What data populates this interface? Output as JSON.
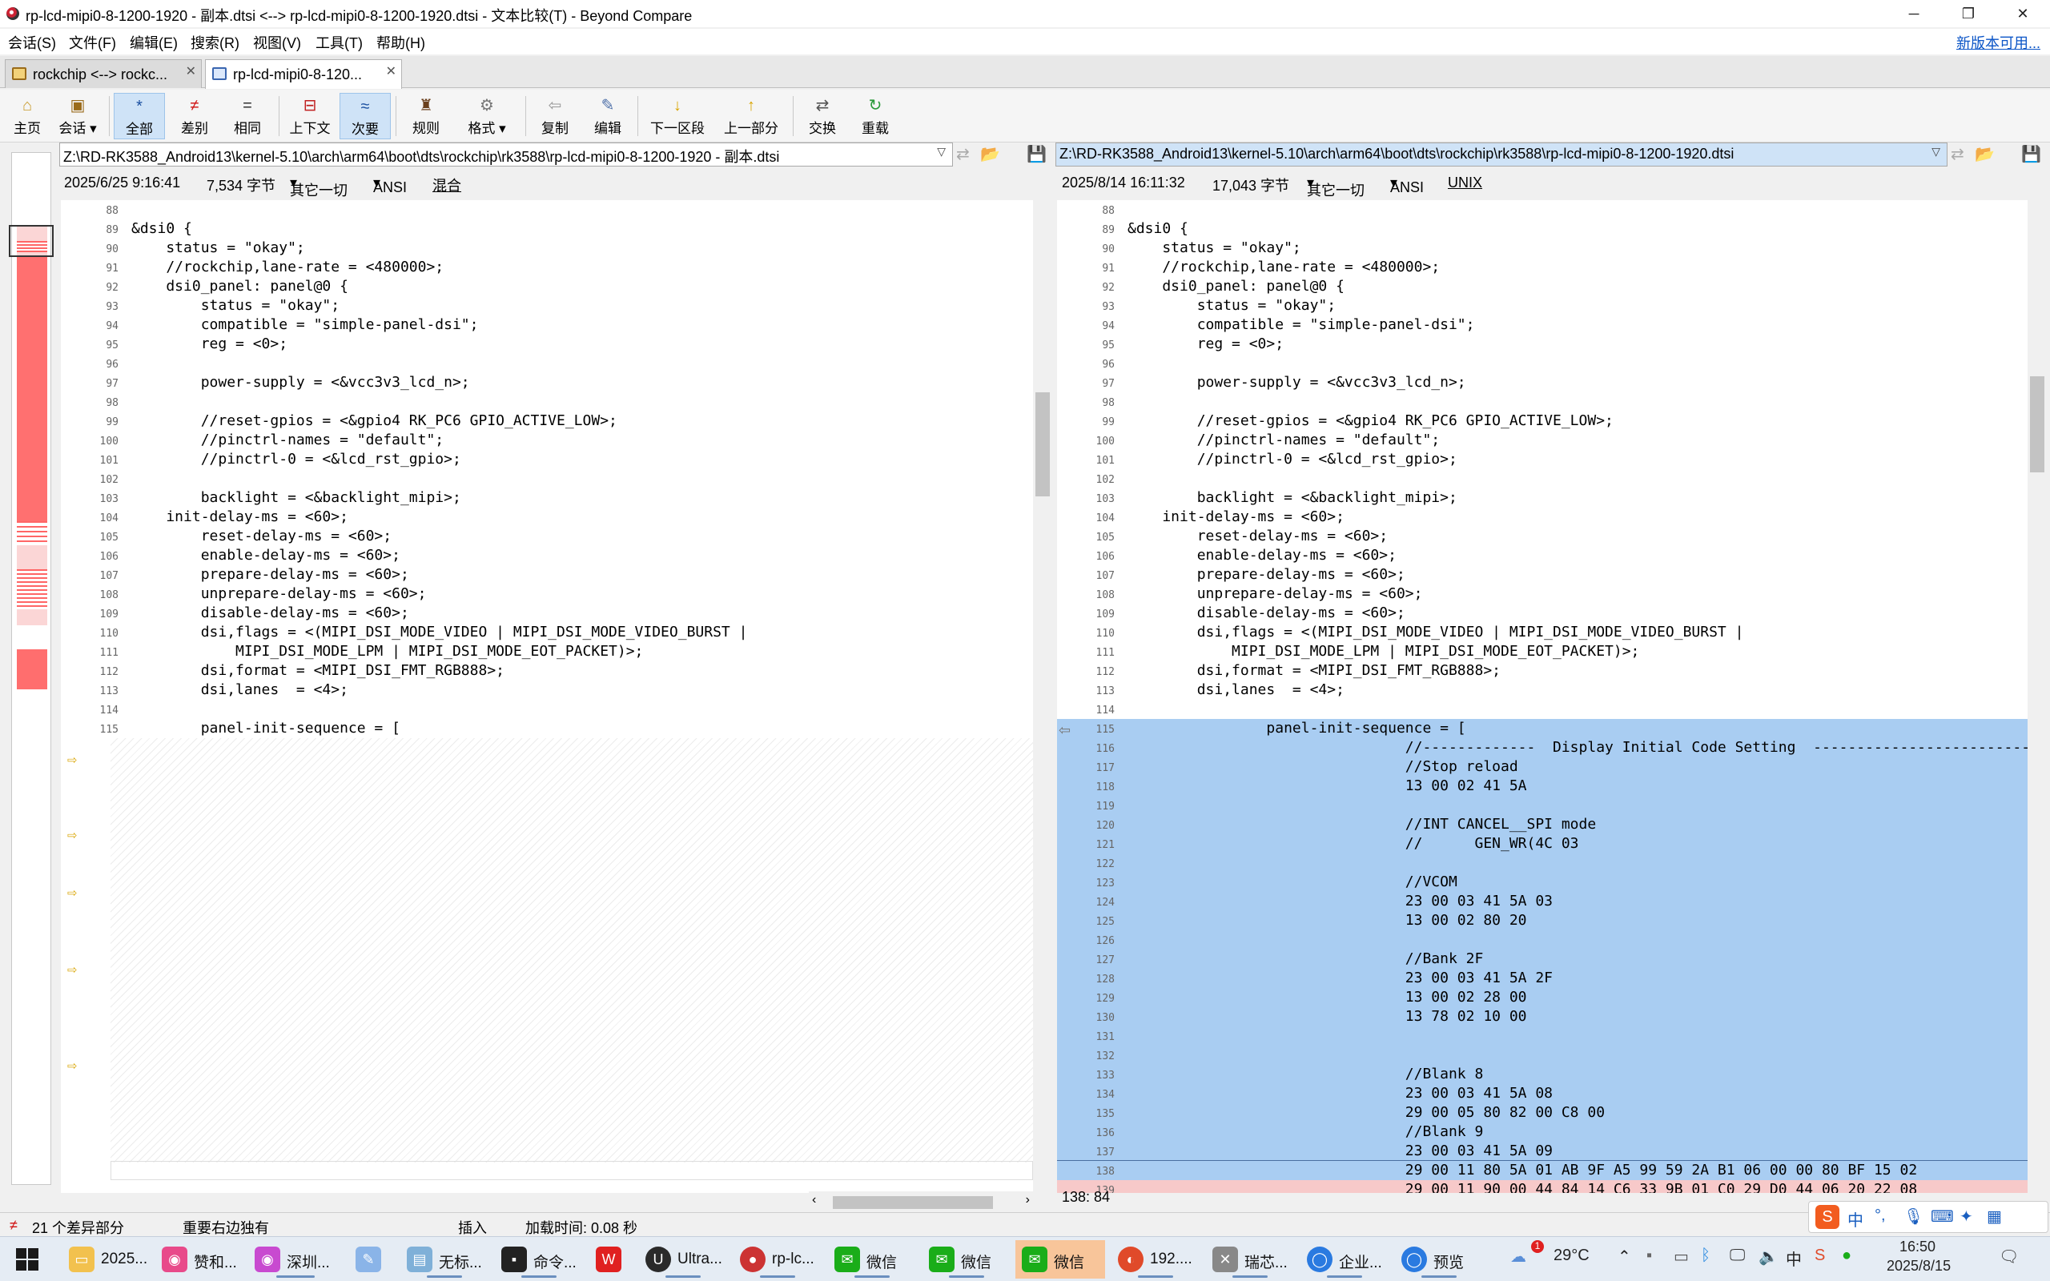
{
  "window": {
    "title": "rp-lcd-mipi0-8-1200-1920 - 副本.dtsi <--> rp-lcd-mipi0-8-1200-1920.dtsi - 文本比较(T) - Beyond Compare"
  },
  "menu": {
    "items": [
      "会话(S)",
      "文件(F)",
      "编辑(E)",
      "搜索(R)",
      "视图(V)",
      "工具(T)",
      "帮助(H)"
    ],
    "new_version": "新版本可用..."
  },
  "tabs": [
    {
      "label": "rockchip <--> rockc..."
    },
    {
      "label": "rp-lcd-mipi0-8-120..."
    }
  ],
  "toolbar": {
    "home": "主页",
    "session": "会话",
    "all": "全部",
    "diffs": "差别",
    "same": "相同",
    "context": "上下文",
    "minor": "次要",
    "rules": "规则",
    "format": "格式",
    "copy": "复制",
    "edit": "编辑",
    "next_section": "下一区段",
    "prev_section": "上一部分",
    "swap": "交换",
    "reload": "重载"
  },
  "left": {
    "path": "Z:\\RD-RK3588_Android13\\kernel-5.10\\arch\\arm64\\boot\\dts\\rockchip\\rk3588\\rp-lcd-mipi0-8-1200-1920 - 副本.dtsi",
    "date": "2025/6/25 9:16:41",
    "size": "7,534 字节",
    "other": "其它一切",
    "encoding": "ANSI",
    "line_ending": "混合"
  },
  "right": {
    "path": "Z:\\RD-RK3588_Android13\\kernel-5.10\\arch\\arm64\\boot\\dts\\rockchip\\rk3588\\rp-lcd-mipi0-8-1200-1920.dtsi",
    "date": "2025/8/14 16:11:32",
    "size": "17,043 字节",
    "other": "其它一切",
    "encoding": "ANSI",
    "line_ending": "UNIX"
  },
  "left_lines": [
    {
      "n": "88",
      "t": ""
    },
    {
      "n": "89",
      "t": "&dsi0 {"
    },
    {
      "n": "90",
      "t": "    status = \"okay\";"
    },
    {
      "n": "91",
      "t": "    //rockchip,lane-rate = <480000>;"
    },
    {
      "n": "92",
      "t": "    dsi0_panel: panel@0 {"
    },
    {
      "n": "93",
      "t": "        status = \"okay\";"
    },
    {
      "n": "94",
      "t": "        compatible = \"simple-panel-dsi\";"
    },
    {
      "n": "95",
      "t": "        reg = <0>;"
    },
    {
      "n": "96",
      "t": ""
    },
    {
      "n": "97",
      "t": "        power-supply = <&vcc3v3_lcd_n>;"
    },
    {
      "n": "98",
      "t": ""
    },
    {
      "n": "99",
      "t": "        //reset-gpios = <&gpio4 RK_PC6 GPIO_ACTIVE_LOW>;"
    },
    {
      "n": "100",
      "t": "        //pinctrl-names = \"default\";"
    },
    {
      "n": "101",
      "t": "        //pinctrl-0 = <&lcd_rst_gpio>;"
    },
    {
      "n": "102",
      "t": ""
    },
    {
      "n": "103",
      "t": "        backlight = <&backlight_mipi>;"
    },
    {
      "n": "104",
      "t": "    init-delay-ms = <60>;"
    },
    {
      "n": "105",
      "t": "        reset-delay-ms = <60>;"
    },
    {
      "n": "106",
      "t": "        enable-delay-ms = <60>;"
    },
    {
      "n": "107",
      "t": "        prepare-delay-ms = <60>;"
    },
    {
      "n": "108",
      "t": "        unprepare-delay-ms = <60>;"
    },
    {
      "n": "109",
      "t": "        disable-delay-ms = <60>;"
    },
    {
      "n": "110",
      "t": "        dsi,flags = <(MIPI_DSI_MODE_VIDEO | MIPI_DSI_MODE_VIDEO_BURST |"
    },
    {
      "n": "111",
      "t": "            MIPI_DSI_MODE_LPM | MIPI_DSI_MODE_EOT_PACKET)>;"
    },
    {
      "n": "112",
      "t": "        dsi,format = <MIPI_DSI_FMT_RGB888>;"
    },
    {
      "n": "113",
      "t": "        dsi,lanes  = <4>;"
    },
    {
      "n": "114",
      "t": ""
    },
    {
      "n": "115",
      "t": "        panel-init-sequence = ["
    }
  ],
  "right_lines": [
    {
      "n": "88",
      "t": "",
      "k": "n"
    },
    {
      "n": "89",
      "t": "&dsi0 {",
      "k": "n"
    },
    {
      "n": "90",
      "t": "    status = \"okay\";",
      "k": "n"
    },
    {
      "n": "91",
      "t": "    //rockchip,lane-rate = <480000>;",
      "k": "n"
    },
    {
      "n": "92",
      "t": "    dsi0_panel: panel@0 {",
      "k": "n"
    },
    {
      "n": "93",
      "t": "        status = \"okay\";",
      "k": "n"
    },
    {
      "n": "94",
      "t": "        compatible = \"simple-panel-dsi\";",
      "k": "n"
    },
    {
      "n": "95",
      "t": "        reg = <0>;",
      "k": "n"
    },
    {
      "n": "96",
      "t": "",
      "k": "n"
    },
    {
      "n": "97",
      "t": "        power-supply = <&vcc3v3_lcd_n>;",
      "k": "n"
    },
    {
      "n": "98",
      "t": "",
      "k": "n"
    },
    {
      "n": "99",
      "t": "        //reset-gpios = <&gpio4 RK_PC6 GPIO_ACTIVE_LOW>;",
      "k": "n"
    },
    {
      "n": "100",
      "t": "        //pinctrl-names = \"default\";",
      "k": "n"
    },
    {
      "n": "101",
      "t": "        //pinctrl-0 = <&lcd_rst_gpio>;",
      "k": "n"
    },
    {
      "n": "102",
      "t": "",
      "k": "n"
    },
    {
      "n": "103",
      "t": "        backlight = <&backlight_mipi>;",
      "k": "n"
    },
    {
      "n": "104",
      "t": "    init-delay-ms = <60>;",
      "k": "n"
    },
    {
      "n": "105",
      "t": "        reset-delay-ms = <60>;",
      "k": "n"
    },
    {
      "n": "106",
      "t": "        enable-delay-ms = <60>;",
      "k": "n"
    },
    {
      "n": "107",
      "t": "        prepare-delay-ms = <60>;",
      "k": "n"
    },
    {
      "n": "108",
      "t": "        unprepare-delay-ms = <60>;",
      "k": "n"
    },
    {
      "n": "109",
      "t": "        disable-delay-ms = <60>;",
      "k": "n"
    },
    {
      "n": "110",
      "t": "        dsi,flags = <(MIPI_DSI_MODE_VIDEO | MIPI_DSI_MODE_VIDEO_BURST |",
      "k": "n"
    },
    {
      "n": "111",
      "t": "            MIPI_DSI_MODE_LPM | MIPI_DSI_MODE_EOT_PACKET)>;",
      "k": "n"
    },
    {
      "n": "112",
      "t": "        dsi,format = <MIPI_DSI_FMT_RGB888>;",
      "k": "n"
    },
    {
      "n": "113",
      "t": "        dsi,lanes  = <4>;",
      "k": "n"
    },
    {
      "n": "114",
      "t": "",
      "k": "n"
    },
    {
      "n": "115",
      "t": "                panel-init-sequence = [",
      "k": "h"
    },
    {
      "n": "116",
      "t": "                                //-------------  Display Initial Code Setting  -------------------------",
      "k": "r"
    },
    {
      "n": "117",
      "t": "                                //Stop reload",
      "k": "r"
    },
    {
      "n": "118",
      "t": "                                13 00 02 41 5A",
      "k": "r"
    },
    {
      "n": "119",
      "t": "",
      "k": "r"
    },
    {
      "n": "120",
      "t": "                                //INT CANCEL__SPI mode",
      "k": "r"
    },
    {
      "n": "121",
      "t": "                                //      GEN_WR(4C 03",
      "k": "r"
    },
    {
      "n": "122",
      "t": "",
      "k": "r"
    },
    {
      "n": "123",
      "t": "                                //VCOM",
      "k": "r"
    },
    {
      "n": "124",
      "t": "                                23 00 03 41 5A 03",
      "k": "r"
    },
    {
      "n": "125",
      "t": "                                13 00 02 80 20",
      "k": "r"
    },
    {
      "n": "126",
      "t": "",
      "k": "r"
    },
    {
      "n": "127",
      "t": "                                //Bank 2F",
      "k": "r"
    },
    {
      "n": "128",
      "t": "                                23 00 03 41 5A 2F",
      "k": "r"
    },
    {
      "n": "129",
      "t": "                                13 00 02 28 00",
      "k": "r"
    },
    {
      "n": "130",
      "t": "                                13 78 02 10 00",
      "k": "r"
    },
    {
      "n": "131",
      "t": "",
      "k": "r"
    },
    {
      "n": "132",
      "t": "",
      "k": "r"
    },
    {
      "n": "133",
      "t": "                                //Blank 8",
      "k": "r"
    },
    {
      "n": "134",
      "t": "                                23 00 03 41 5A 08",
      "k": "r"
    },
    {
      "n": "135",
      "t": "                                29 00 05 80 82 00 C8 00",
      "k": "r"
    },
    {
      "n": "136",
      "t": "                                //Blank 9",
      "k": "r"
    },
    {
      "n": "137",
      "t": "                                23 00 03 41 5A 09",
      "k": "r"
    },
    {
      "n": "138",
      "t": "                                29 00 11 80 5A 01 AB 9F A5 99 59 2A B1 06 00 00 80 BF 15 02",
      "k": "r"
    },
    {
      "n": "139",
      "t": "                                29 00 11 90 00 44 84 14 C6 33 9B 01 C0 29 D0 44 06 20 22 08",
      "k": "r"
    }
  ],
  "status": {
    "diff_count": "21 个差异部分",
    "important": "重要右边独有",
    "mode": "插入",
    "load_time": "加载时间: 0.08 秒",
    "cursor": "138: 84"
  },
  "taskbar": {
    "items": [
      "2025...",
      "赞和...",
      "深圳...",
      "无标...",
      "命令...",
      "Ultra...",
      "rp-lc...",
      "微信",
      "微信",
      "微信",
      "192....",
      "瑞芯...",
      "企业...",
      "预览"
    ],
    "weather": "29°C",
    "ime": "中",
    "time": "16:50",
    "date": "2025/8/15"
  },
  "colors": {
    "insert_bg": "#a9cdf2",
    "diff_text": "#e00000",
    "accent": "#0b55c7"
  }
}
